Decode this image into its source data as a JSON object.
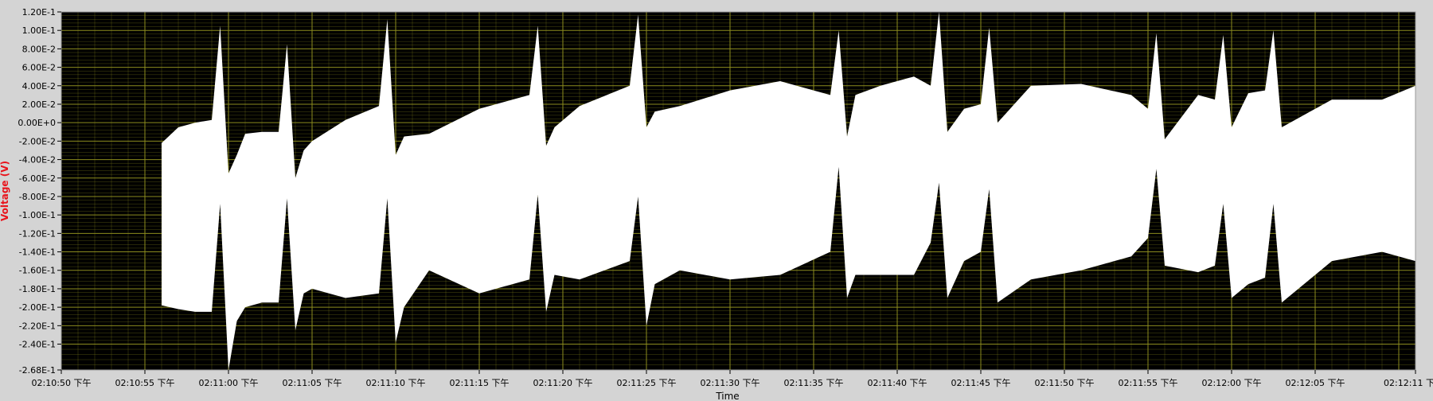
{
  "window": {
    "title": ""
  },
  "chart_data": {
    "type": "area",
    "title": "",
    "xlabel": "Time",
    "ylabel": "Voltage (V)",
    "grid": true,
    "x_axis_kind": "time",
    "y_ticks": [
      "1.20E-1",
      "1.00E-1",
      "8.00E-2",
      "6.00E-2",
      "4.00E-2",
      "2.00E-2",
      "0.00E+0",
      "-2.00E-2",
      "-4.00E-2",
      "-6.00E-2",
      "-8.00E-2",
      "-1.00E-1",
      "-1.20E-1",
      "-1.40E-1",
      "-1.60E-1",
      "-1.80E-1",
      "-2.00E-1",
      "-2.20E-1",
      "-2.40E-1",
      "-2.68E-1"
    ],
    "y_tick_values": [
      0.12,
      0.1,
      0.08,
      0.06,
      0.04,
      0.02,
      0.0,
      -0.02,
      -0.04,
      -0.06,
      -0.08,
      -0.1,
      -0.12,
      -0.14,
      -0.16,
      -0.18,
      -0.2,
      -0.22,
      -0.24,
      -0.268
    ],
    "ylim": [
      -0.268,
      0.12
    ],
    "x_ticks": [
      "02:10:50 下午",
      "02:10:55 下午",
      "02:11:00 下午",
      "02:11:05 下午",
      "02:11:10 下午",
      "02:11:15 下午",
      "02:11:20 下午",
      "02:11:25 下午",
      "02:11:30 下午",
      "02:11:35 下午",
      "02:11:40 下午",
      "02:11:45 下午",
      "02:11:50 下午",
      "02:11:55 下午",
      "02:12:00 下午",
      "02:12:05 下午",
      "02:12:11 下"
    ],
    "xlim": [
      "02:10:50",
      "02:12:11"
    ],
    "colors": {
      "plot_bg": "#000000",
      "grid": "#8c8c1e",
      "signal": "#ffffff",
      "frame": "#d4d4d4",
      "ylabel": "#e8141c"
    },
    "series": [
      {
        "x": [
          "02:10:56",
          "02:10:57",
          "02:10:58",
          "02:10:59",
          "02:10:59.5",
          "02:11:00",
          "02:11:00.5",
          "02:11:01",
          "02:11:02",
          "02:11:03",
          "02:11:03.5",
          "02:11:04",
          "02:11:04.5",
          "02:11:05",
          "02:11:07",
          "02:11:09",
          "02:11:09.5",
          "02:11:10",
          "02:11:10.5",
          "02:11:12",
          "02:11:15",
          "02:11:18",
          "02:11:18.5",
          "02:11:19",
          "02:11:19.5",
          "02:11:21",
          "02:11:24",
          "02:11:24.5",
          "02:11:25",
          "02:11:25.5",
          "02:11:27",
          "02:11:30",
          "02:11:33",
          "02:11:36",
          "02:11:36.5",
          "02:11:37",
          "02:11:37.5",
          "02:11:39",
          "02:11:41",
          "02:11:42",
          "02:11:42.5",
          "02:11:43",
          "02:11:44",
          "02:11:45",
          "02:11:45.5",
          "02:11:46",
          "02:11:48",
          "02:11:51",
          "02:11:54",
          "02:11:55",
          "02:11:55.5",
          "02:11:56",
          "02:11:58",
          "02:11:59",
          "02:11:59.5",
          "02:12:00",
          "02:12:01",
          "02:12:02",
          "02:12:02.5",
          "02:12:03",
          "02:12:06",
          "02:12:09",
          "02:12:11"
        ],
        "upper": [
          -0.022,
          -0.005,
          0.0,
          0.003,
          0.105,
          -0.055,
          -0.035,
          -0.012,
          -0.01,
          -0.01,
          0.085,
          -0.06,
          -0.03,
          -0.02,
          0.003,
          0.018,
          0.112,
          -0.035,
          -0.015,
          -0.012,
          0.015,
          0.03,
          0.105,
          -0.025,
          -0.005,
          0.018,
          0.04,
          0.117,
          -0.005,
          0.012,
          0.018,
          0.035,
          0.045,
          0.03,
          0.1,
          -0.015,
          0.03,
          0.04,
          0.05,
          0.04,
          0.12,
          -0.01,
          0.015,
          0.02,
          0.103,
          0.0,
          0.04,
          0.042,
          0.03,
          0.015,
          0.097,
          -0.018,
          0.03,
          0.025,
          0.095,
          -0.005,
          0.032,
          0.035,
          0.1,
          -0.005,
          0.025,
          0.025,
          0.04
        ],
        "lower": [
          -0.198,
          -0.202,
          -0.205,
          -0.205,
          -0.088,
          -0.268,
          -0.215,
          -0.2,
          -0.195,
          -0.195,
          -0.082,
          -0.225,
          -0.185,
          -0.18,
          -0.19,
          -0.185,
          -0.082,
          -0.238,
          -0.2,
          -0.16,
          -0.185,
          -0.17,
          -0.078,
          -0.205,
          -0.165,
          -0.17,
          -0.15,
          -0.08,
          -0.22,
          -0.175,
          -0.16,
          -0.17,
          -0.165,
          -0.14,
          -0.048,
          -0.19,
          -0.165,
          -0.165,
          -0.165,
          -0.13,
          -0.065,
          -0.19,
          -0.15,
          -0.14,
          -0.072,
          -0.195,
          -0.17,
          -0.16,
          -0.145,
          -0.125,
          -0.05,
          -0.155,
          -0.162,
          -0.155,
          -0.088,
          -0.19,
          -0.175,
          -0.168,
          -0.088,
          -0.195,
          -0.15,
          -0.14,
          -0.15
        ]
      }
    ]
  }
}
